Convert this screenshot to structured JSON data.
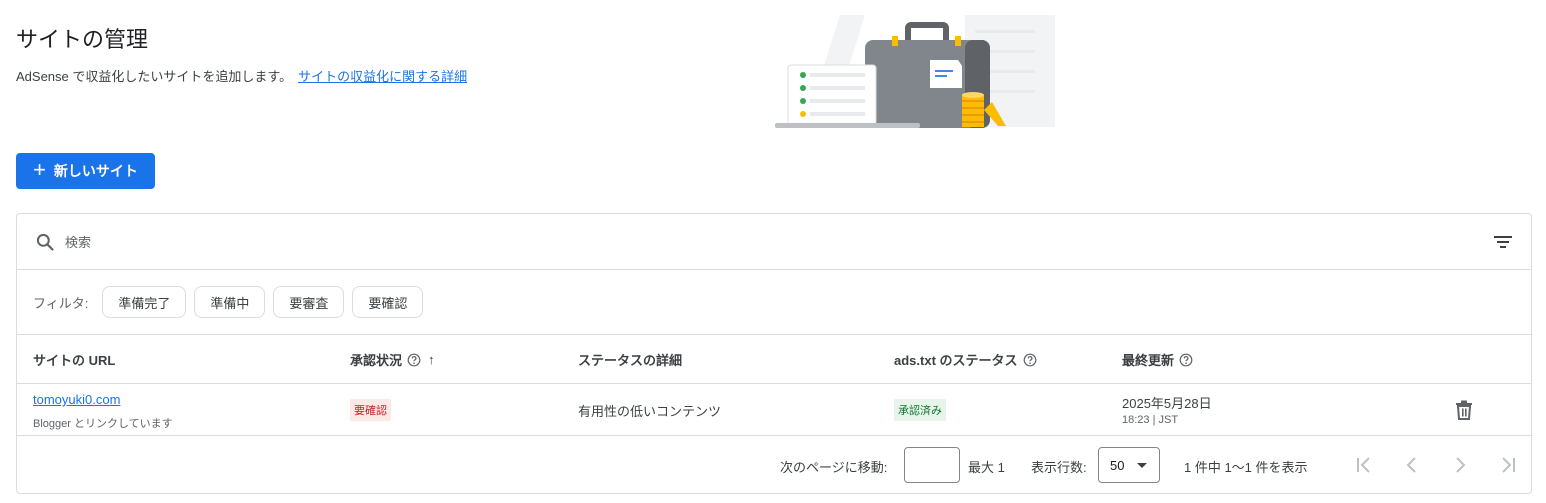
{
  "header": {
    "title": "サイトの管理",
    "subtitle": "AdSense で収益化したいサイトを追加します。",
    "help_link": "サイトの収益化に関する詳細"
  },
  "actions": {
    "new_site_label": "新しいサイト"
  },
  "search": {
    "placeholder": "検索"
  },
  "filters": {
    "label": "フィルタ:",
    "chips": [
      "準備完了",
      "準備中",
      "要審査",
      "要確認"
    ]
  },
  "table": {
    "columns": {
      "url": "サイトの URL",
      "approval": "承認状況",
      "detail": "ステータスの詳細",
      "ads_txt": "ads.txt のステータス",
      "updated": "最終更新"
    },
    "rows": [
      {
        "url": "tomoyuki0.com",
        "sub": "Blogger とリンクしています",
        "approval": "要確認",
        "detail": "有用性の低いコンテンツ",
        "ads_txt": "承認済み",
        "updated_date": "2025年5月28日",
        "updated_time": "18:23 | JST"
      }
    ]
  },
  "pagination": {
    "goto_label": "次のページに移動:",
    "goto_value": "",
    "max_label": "最大 1",
    "rows_label": "表示行数:",
    "rows_value": "50",
    "range_label": "1 件中 1〜1 件を表示"
  },
  "colors": {
    "primary": "#1a73e8",
    "error_bg": "#fce8e6",
    "error_text": "#c5221f",
    "success_bg": "#e6f4ea",
    "success_text": "#137333"
  },
  "icons": [
    "search-icon",
    "filter-list-icon",
    "help-icon",
    "arrow-upward-icon",
    "delete-icon",
    "first-page-icon",
    "chevron-left-icon",
    "chevron-right-icon",
    "last-page-icon",
    "plus-icon"
  ]
}
